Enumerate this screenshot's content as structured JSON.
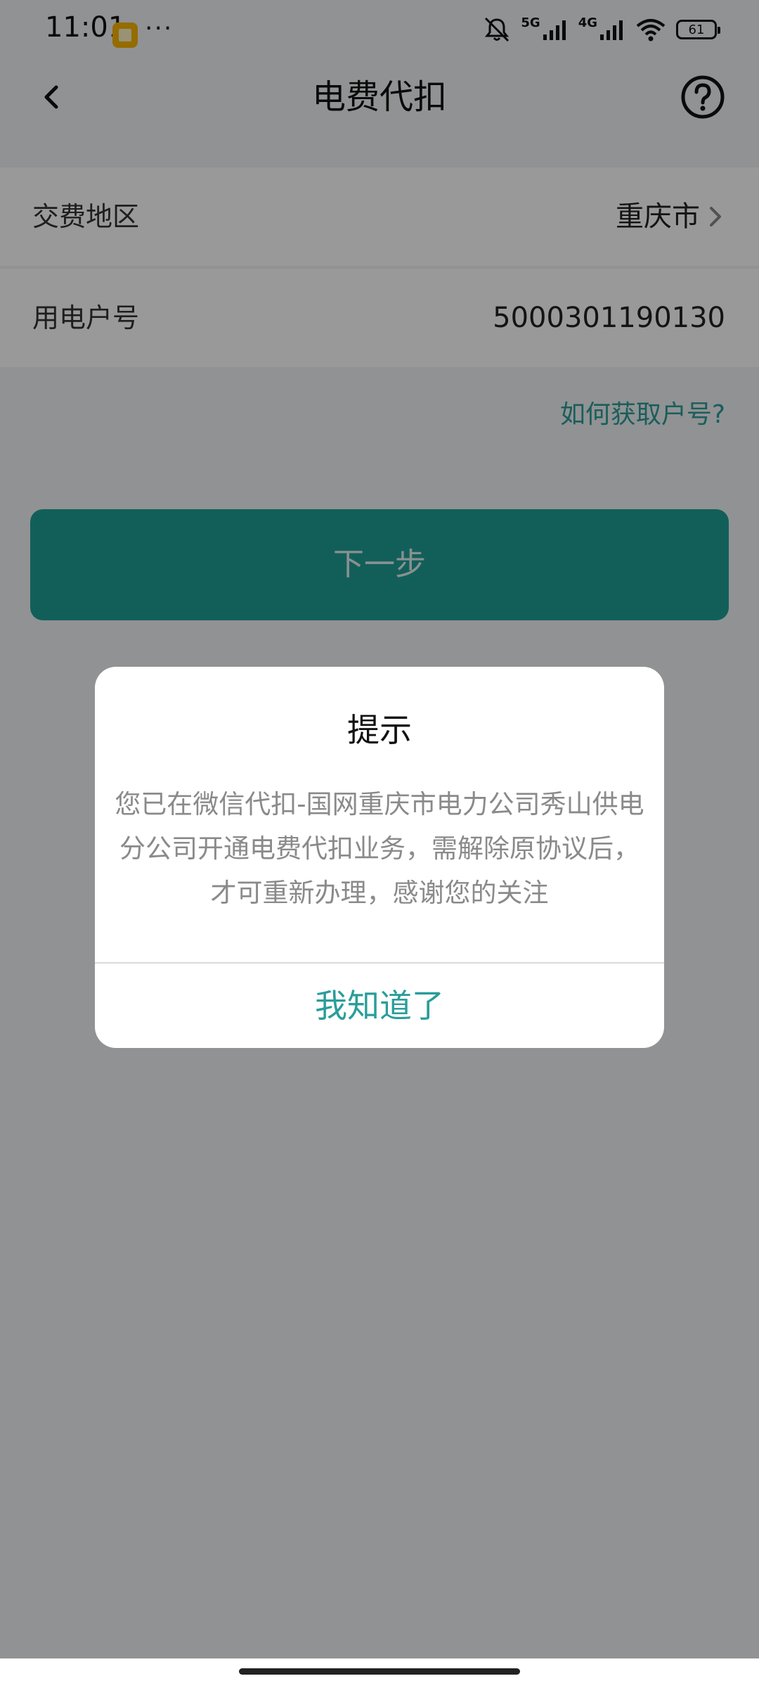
{
  "status_bar": {
    "time": "11:01",
    "more": "···",
    "network_5g": "5G",
    "network_4g": "4G",
    "battery": "61"
  },
  "nav": {
    "title": "电费代扣"
  },
  "form": {
    "region_label": "交费地区",
    "region_value": "重庆市",
    "account_label": "用电户号",
    "account_value": "5000301190130",
    "help_link": "如何获取户号?",
    "next_button": "下一步"
  },
  "dialog": {
    "title": "提示",
    "message": "您已在微信代扣-国网重庆市电力公司秀山供电分公司开通电费代扣业务，需解除原协议后，才可重新办理，感谢您的关注",
    "confirm_button": "我知道了"
  },
  "colors": {
    "accent": "#2a9d9a",
    "button_bg": "#1f9e97",
    "overlay": "rgba(0,0,0,0.40)"
  },
  "icons": {
    "back": "back-arrow-icon",
    "help": "question-circle-icon",
    "chevron": "chevron-right-icon",
    "mute": "bell-mute-icon",
    "wifi": "wifi-icon",
    "signal": "signal-bars-icon",
    "battery": "battery-icon"
  }
}
